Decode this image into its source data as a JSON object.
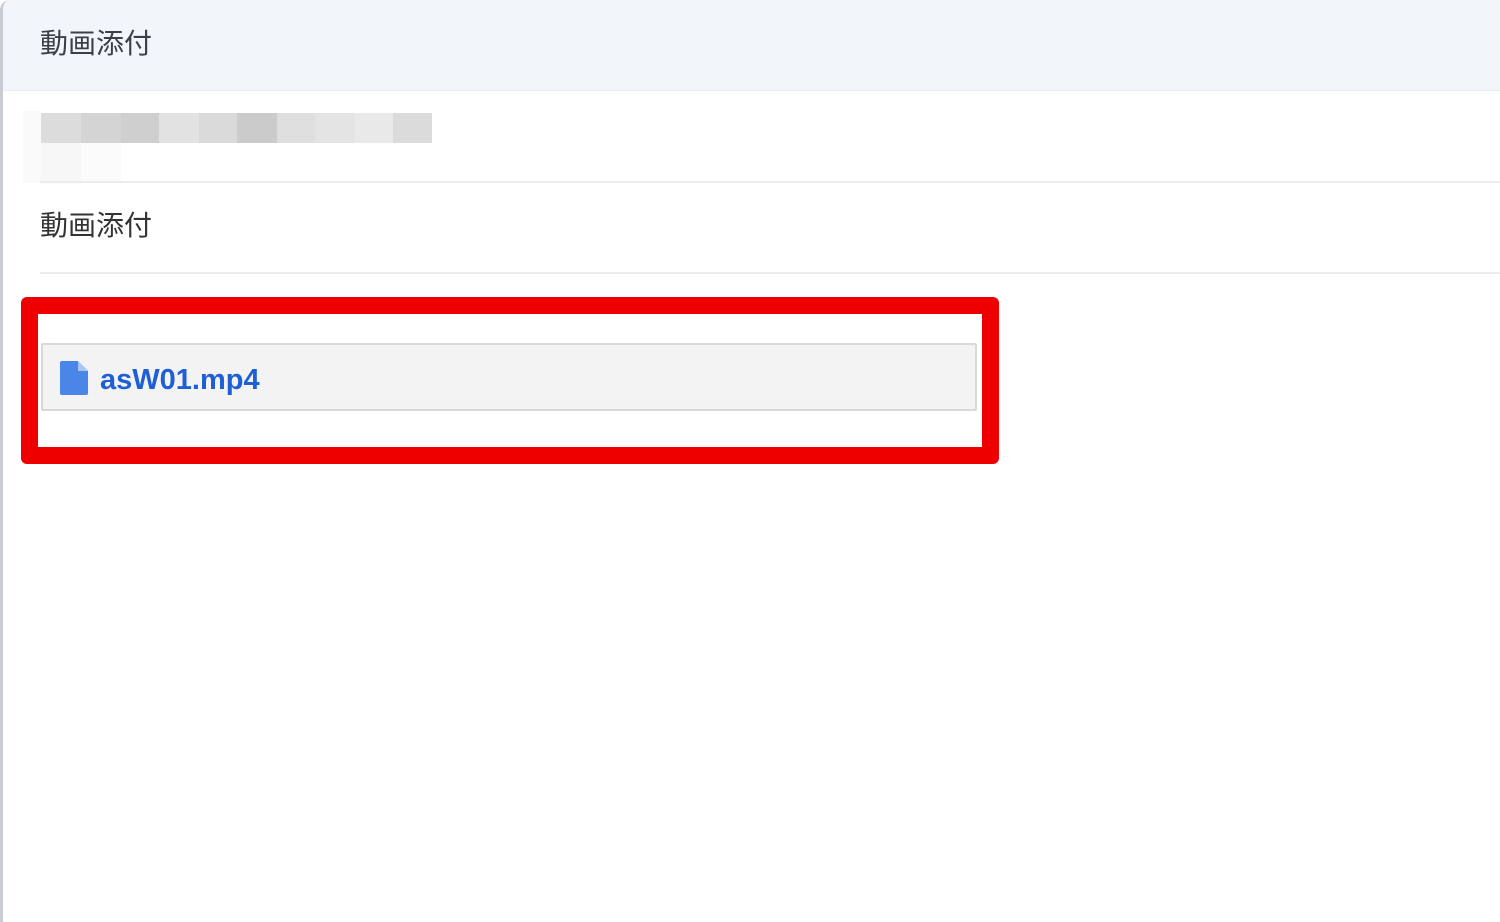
{
  "header": {
    "title": "動画添付"
  },
  "section": {
    "title": "動画添付"
  },
  "attachment": {
    "file_name": "asW01.mp4",
    "icon": "file-icon"
  },
  "colors": {
    "header_bg": "#f2f5fa",
    "highlight": "#ee0000",
    "link": "#1f5fd6",
    "icon": "#4a86e8"
  }
}
